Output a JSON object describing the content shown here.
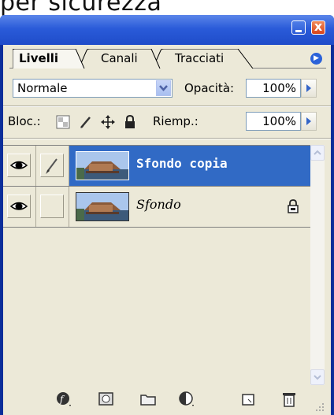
{
  "top_fragment": "per sicurezza",
  "window": {
    "minimize_label": "minimize",
    "close_label": "x"
  },
  "tabs": [
    {
      "label": "Livelli",
      "active": true
    },
    {
      "label": "Canali",
      "active": false
    },
    {
      "label": "Tracciati",
      "active": false
    }
  ],
  "blend": {
    "mode": "Normale",
    "opacity_label": "Opacità:",
    "opacity_value": "100%"
  },
  "lock": {
    "label": "Bloc.:",
    "fill_label": "Riemp.:",
    "fill_value": "100%",
    "icons": [
      "lock-transparency-icon",
      "lock-image-icon",
      "lock-position-icon",
      "lock-all-icon"
    ]
  },
  "layers": [
    {
      "name": "Sfondo copia",
      "selected": true,
      "visible": true,
      "brush": true,
      "locked": false
    },
    {
      "name": "Sfondo",
      "selected": false,
      "visible": true,
      "brush": false,
      "locked": true
    }
  ],
  "bottom_icons": [
    "layer-style-icon",
    "layer-mask-icon",
    "new-group-icon",
    "adjustment-layer-icon",
    "new-layer-icon",
    "trash-icon"
  ],
  "colors": {
    "title_bar": "#2a5bd9",
    "panel_bg": "#ece9d8",
    "selection": "#316ac5"
  }
}
